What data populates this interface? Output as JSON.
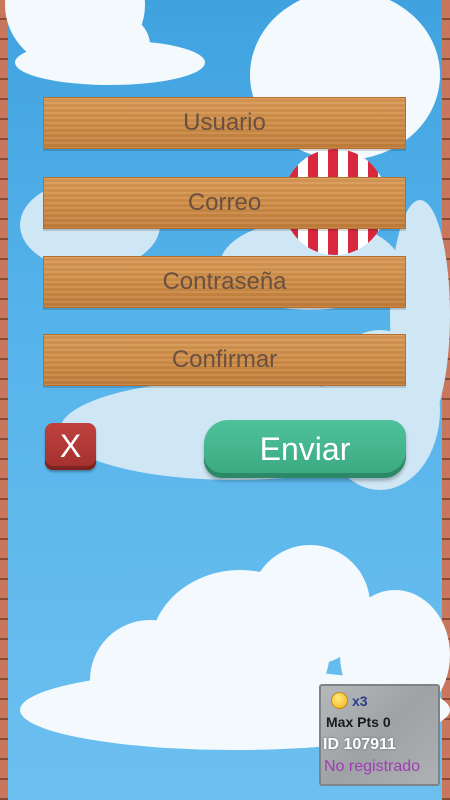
{
  "form": {
    "username_placeholder": "Usuario",
    "email_placeholder": "Correo",
    "password_placeholder": "Contraseña",
    "confirm_placeholder": "Confirmar"
  },
  "buttons": {
    "close_label": "X",
    "send_label": "Enviar"
  },
  "stats": {
    "coin_count": "x3",
    "max_points_label": "Max Pts",
    "max_points_value": "0",
    "id_text": "ID 107911",
    "registration_status": "No registrado"
  },
  "colors": {
    "sky": "#56b3ea",
    "wood": "#cf8c46",
    "send_button": "#3aa880",
    "close_button": "#a3302e",
    "status_text": "#a23ab7"
  },
  "icons": [
    "coin-icon",
    "balloon-icon"
  ]
}
